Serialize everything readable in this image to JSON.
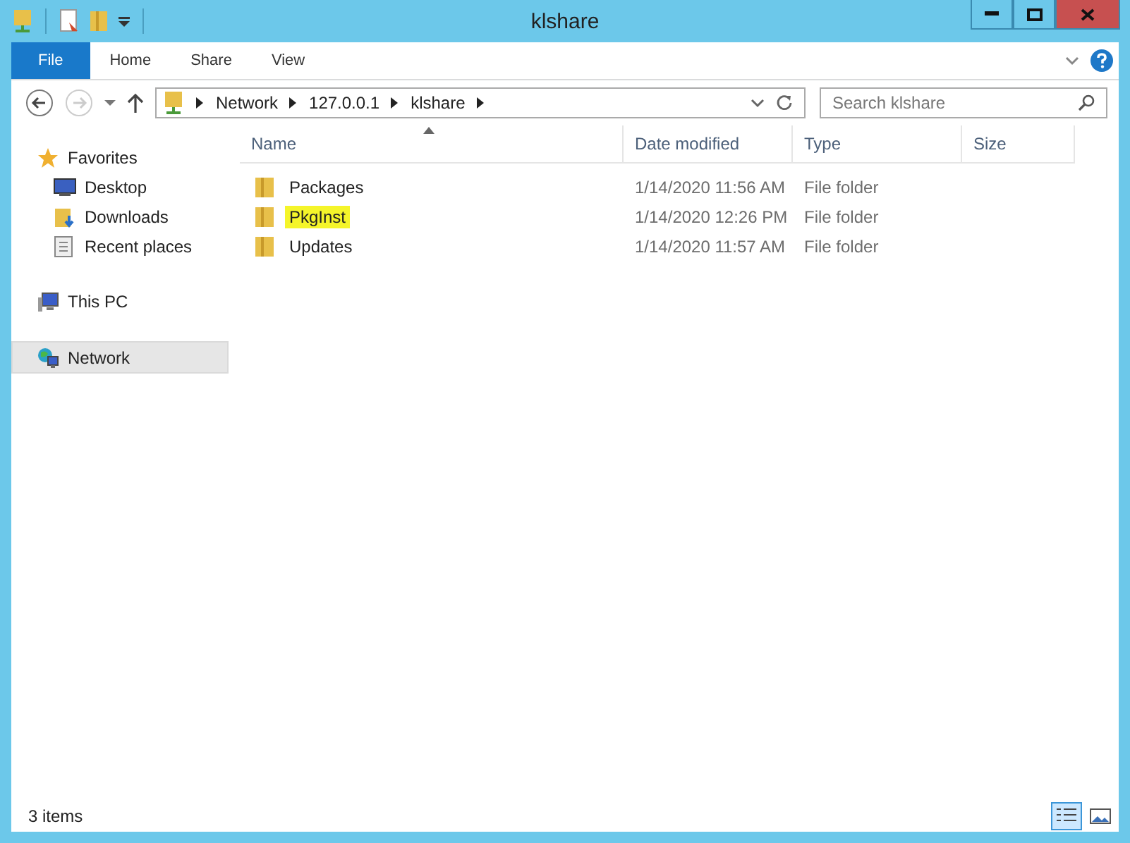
{
  "window": {
    "title": "klshare"
  },
  "ribbon_tabs": [
    {
      "label": "File",
      "selected": true
    },
    {
      "label": "Home",
      "selected": false
    },
    {
      "label": "Share",
      "selected": false
    },
    {
      "label": "View",
      "selected": false
    }
  ],
  "address": {
    "crumbs": [
      "Network",
      "127.0.0.1",
      "klshare"
    ]
  },
  "search": {
    "placeholder": "Search klshare"
  },
  "sidebar": {
    "groups": [
      {
        "label": "Favorites",
        "selected": false,
        "children": [
          {
            "label": "Desktop",
            "selected": false
          },
          {
            "label": "Downloads",
            "selected": false
          },
          {
            "label": "Recent places",
            "selected": false
          }
        ]
      },
      {
        "label": "This PC",
        "selected": false
      },
      {
        "label": "Network",
        "selected": true
      }
    ]
  },
  "table": {
    "columns": [
      "Name",
      "Date modified",
      "Type",
      "Size"
    ],
    "rows": [
      {
        "name": "Packages",
        "date": "1/14/2020 11:56 AM",
        "type": "File folder",
        "highlighted": false
      },
      {
        "name": "PkgInst",
        "date": "1/14/2020 12:26 PM",
        "type": "File folder",
        "highlighted": true
      },
      {
        "name": "Updates",
        "date": "1/14/2020 11:57 AM",
        "type": "File folder",
        "highlighted": false
      }
    ]
  },
  "status_bar": {
    "text": "3 items"
  }
}
